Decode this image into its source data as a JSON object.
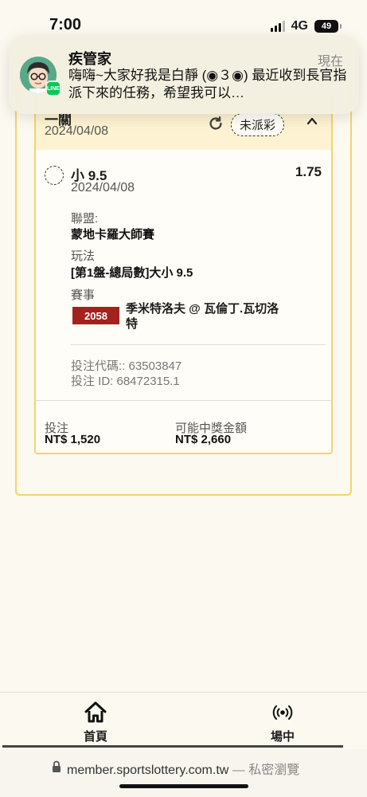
{
  "status_bar": {
    "time": "7:00",
    "network": "4G",
    "battery": "49"
  },
  "notification": {
    "title": "疾管家",
    "time": "現在",
    "body": "嗨嗨~大家好我是白靜 (◉３◉) 最近收到長官指派下來的任務，希望我可以…",
    "badge": "LINE"
  },
  "bet_card": {
    "header_title": "一關",
    "header_date": "2024/04/08",
    "status": "未派彩",
    "selection": {
      "name": "小 9.5",
      "odds": "1.75",
      "date": "2024/04/08",
      "league_label": "聯盟:",
      "league_value": "蒙地卡羅大師賽",
      "play_label": "玩法",
      "play_value": "[第1盤-總局數]大小 9.5",
      "match_label": "賽事",
      "match_code": "2058",
      "match_name": "季米特洛夫 @ 瓦倫丁.瓦切洛特"
    },
    "bet_code": "投注代碼:: 63503847",
    "bet_id": "投注 ID: 68472315.1",
    "stake_label": "投注",
    "stake_value": "NT$ 1,520",
    "payout_label": "可能中獎金額",
    "payout_value": "NT$ 2,660"
  },
  "bottom_nav": {
    "items": [
      {
        "label": "首頁",
        "icon": "home-icon"
      },
      {
        "label": "場中",
        "icon": "live-broadcast-icon"
      }
    ]
  },
  "browser": {
    "url": "member.sportslottery.com.tw",
    "mode": "— 私密瀏覽"
  }
}
